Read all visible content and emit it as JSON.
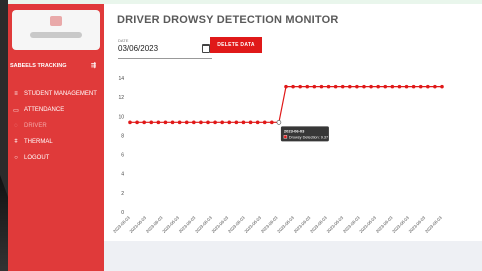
{
  "sidebar": {
    "brand": "SABEELS TRACKING",
    "items": [
      {
        "label": "STUDENT MANAGEMENT",
        "icon": "list-icon"
      },
      {
        "label": "ATTENDANCE",
        "icon": "calendar-icon"
      },
      {
        "label": "DRIVER",
        "icon": "driver-icon"
      },
      {
        "label": "THERMAL",
        "icon": "thermometer-icon"
      },
      {
        "label": "LOGOUT",
        "icon": "logout-icon"
      }
    ],
    "active_index": 2
  },
  "header": {
    "title": "DRIVER DROWSY DETECTION MONITOR",
    "date_label": "DATE",
    "date_value": "03/06/2023",
    "delete_label": "DELETE DATA"
  },
  "colors": {
    "sidebar": "#e03a3a",
    "accent": "#e01919",
    "line": "#e01919"
  },
  "chart_data": {
    "type": "line",
    "title": "",
    "xlabel": "",
    "ylabel": "",
    "ylim": [
      0,
      14
    ],
    "yticks": [
      0,
      2,
      4,
      6,
      8,
      10,
      12,
      14
    ],
    "categories": [
      "2023-06-03",
      "2023-06-03",
      "2023-06-03",
      "2023-06-03",
      "2023-06-03",
      "2023-06-03",
      "2023-06-03",
      "2023-06-03",
      "2023-06-03",
      "2023-06-03",
      "2023-06-03",
      "2023-06-03",
      "2023-06-03",
      "2023-06-03",
      "2023-06-03",
      "2023-06-03",
      "2023-06-03",
      "2023-06-03",
      "2023-06-03",
      "2023-06-03"
    ],
    "series": [
      {
        "name": "Drowsy Detection",
        "values": [
          9.37,
          9.37,
          9.37,
          9.37,
          9.37,
          9.37,
          9.37,
          9.37,
          9.37,
          9.37,
          9.37,
          9.37,
          9.37,
          9.37,
          9.37,
          9.37,
          9.37,
          9.37,
          9.37,
          9.37,
          9.37,
          9.37,
          13.1,
          13.1,
          13.1,
          13.1,
          13.1,
          13.1,
          13.1,
          13.1,
          13.1,
          13.1,
          13.1,
          13.1,
          13.1,
          13.1,
          13.1,
          13.1,
          13.1,
          13.1,
          13.1,
          13.1,
          13.1,
          13.1,
          13.1
        ]
      }
    ],
    "tooltip": {
      "point_index": 21,
      "date": "2023-06-03",
      "text": "Drowsy Detection: 9.37"
    },
    "grid": false,
    "legend": "none"
  }
}
